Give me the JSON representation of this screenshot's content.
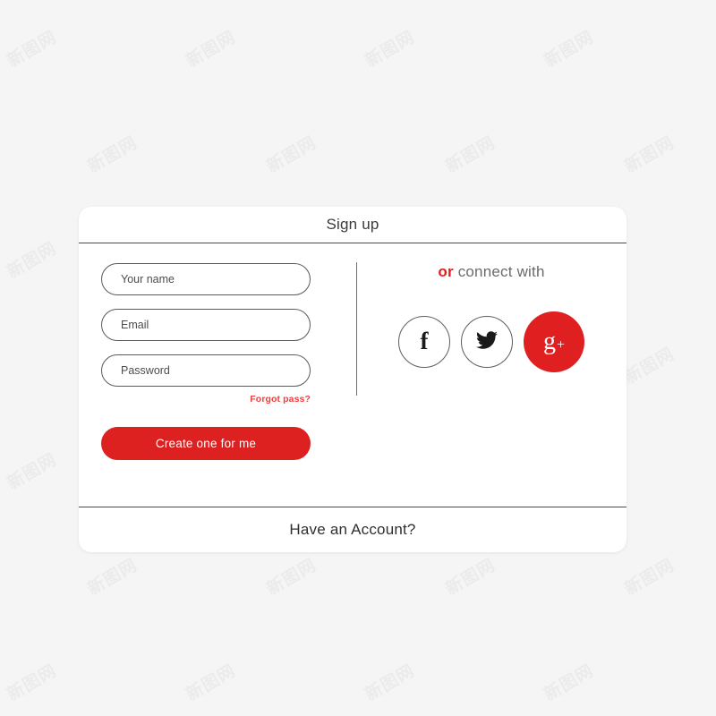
{
  "page": {
    "background_color": "#f5f5f5",
    "accent_color": "#dd2020",
    "watermark_text": "新图网"
  },
  "card": {
    "header": {
      "title": "Sign up"
    },
    "form": {
      "fields": [
        {
          "name": "your-name",
          "placeholder": "Your name",
          "value": ""
        },
        {
          "name": "email",
          "placeholder": "Email",
          "value": ""
        },
        {
          "name": "password",
          "placeholder": "Password",
          "value": ""
        }
      ],
      "forgot_link": "Forgot pass?",
      "submit_label": "Create one for me"
    },
    "social": {
      "heading_accent": "or",
      "heading_rest": " connect with",
      "buttons": [
        {
          "name": "facebook",
          "glyph": "f",
          "style": "outline"
        },
        {
          "name": "twitter",
          "glyph": "twitter-bird",
          "style": "outline"
        },
        {
          "name": "google-plus",
          "glyph": "g+",
          "style": "filled",
          "color": "#e01f20"
        }
      ]
    },
    "footer": {
      "text": "Have an Account?"
    }
  }
}
